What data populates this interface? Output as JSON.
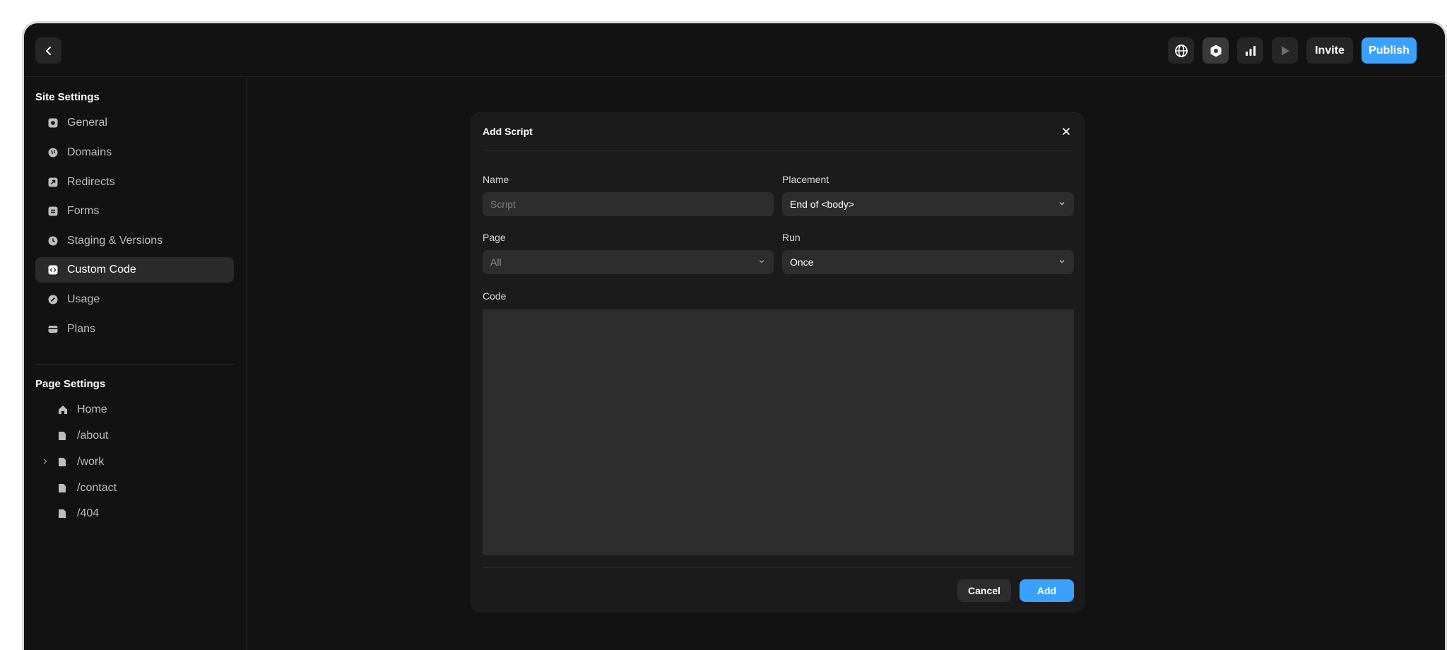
{
  "topbar": {
    "back_icon": "chevron-left-icon",
    "tools": [
      {
        "icon": "globe-icon"
      },
      {
        "icon": "settings-hex-icon"
      },
      {
        "icon": "bar-chart-icon"
      },
      {
        "icon": "play-icon"
      }
    ],
    "invite_label": "Invite",
    "publish_label": "Publish"
  },
  "colors": {
    "accent": "#3aa1ff",
    "background": "#121212",
    "field": "#2d2d2d"
  },
  "sidebar": {
    "site_settings_title": "Site Settings",
    "site_items": [
      {
        "label": "General",
        "icon": "settings-square-icon"
      },
      {
        "label": "Domains",
        "icon": "globe-icon"
      },
      {
        "label": "Redirects",
        "icon": "redirect-icon"
      },
      {
        "label": "Forms",
        "icon": "form-icon"
      },
      {
        "label": "Staging & Versions",
        "icon": "clock-icon"
      },
      {
        "label": "Custom Code",
        "icon": "code-icon",
        "active": true
      },
      {
        "label": "Usage",
        "icon": "gauge-icon"
      },
      {
        "label": "Plans",
        "icon": "card-icon"
      }
    ],
    "page_settings_title": "Page Settings",
    "pages": [
      {
        "label": "Home",
        "icon": "home-icon"
      },
      {
        "label": "/about",
        "icon": "file-icon"
      },
      {
        "label": "/work",
        "icon": "file-icon",
        "expandable": true
      },
      {
        "label": "/contact",
        "icon": "file-icon"
      },
      {
        "label": "/404",
        "icon": "file-icon"
      }
    ]
  },
  "modal": {
    "title": "Add Script",
    "name_label": "Name",
    "name_placeholder": "Script",
    "placement_label": "Placement",
    "placement_value": "End of <body>",
    "page_label": "Page",
    "page_value": "All",
    "run_label": "Run",
    "run_value": "Once",
    "code_label": "Code",
    "cancel_label": "Cancel",
    "add_label": "Add"
  }
}
